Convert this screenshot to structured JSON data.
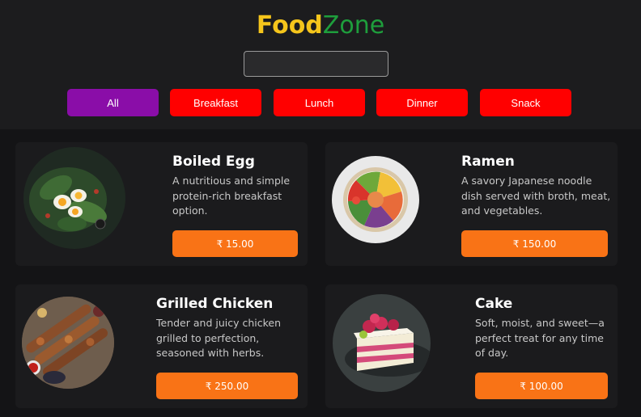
{
  "app": {
    "logo_part1": "Food",
    "logo_part2": "Zone",
    "accent_yellow": "#f5c51b",
    "accent_green": "#1e9e3c"
  },
  "search": {
    "value": "",
    "placeholder": ""
  },
  "filters": [
    {
      "label": "All",
      "active": true,
      "color": "#8a0da8"
    },
    {
      "label": "Breakfast",
      "active": false,
      "color": "#ff0000"
    },
    {
      "label": "Lunch",
      "active": false,
      "color": "#ff0000"
    },
    {
      "label": "Dinner",
      "active": false,
      "color": "#ff0000"
    },
    {
      "label": "Snack",
      "active": false,
      "color": "#ff0000"
    }
  ],
  "foods": [
    {
      "name": "Boiled Egg",
      "description": "A nutritious and simple protein-rich breakfast option.",
      "price": "₹ 15.00",
      "image_icon": "boiled-egg-image"
    },
    {
      "name": "Ramen",
      "description": "A savory Japanese noodle dish served with broth, meat, and vegetables.",
      "price": "₹ 150.00",
      "image_icon": "ramen-bowl-image"
    },
    {
      "name": "Grilled Chicken",
      "description": "Tender and juicy chicken grilled to perfection, seasoned with herbs.",
      "price": "₹ 250.00",
      "image_icon": "grilled-chicken-image"
    },
    {
      "name": "Cake",
      "description": "Soft, moist, and sweet—a perfect treat for any time of day.",
      "price": "₹ 100.00",
      "image_icon": "cake-image"
    }
  ]
}
